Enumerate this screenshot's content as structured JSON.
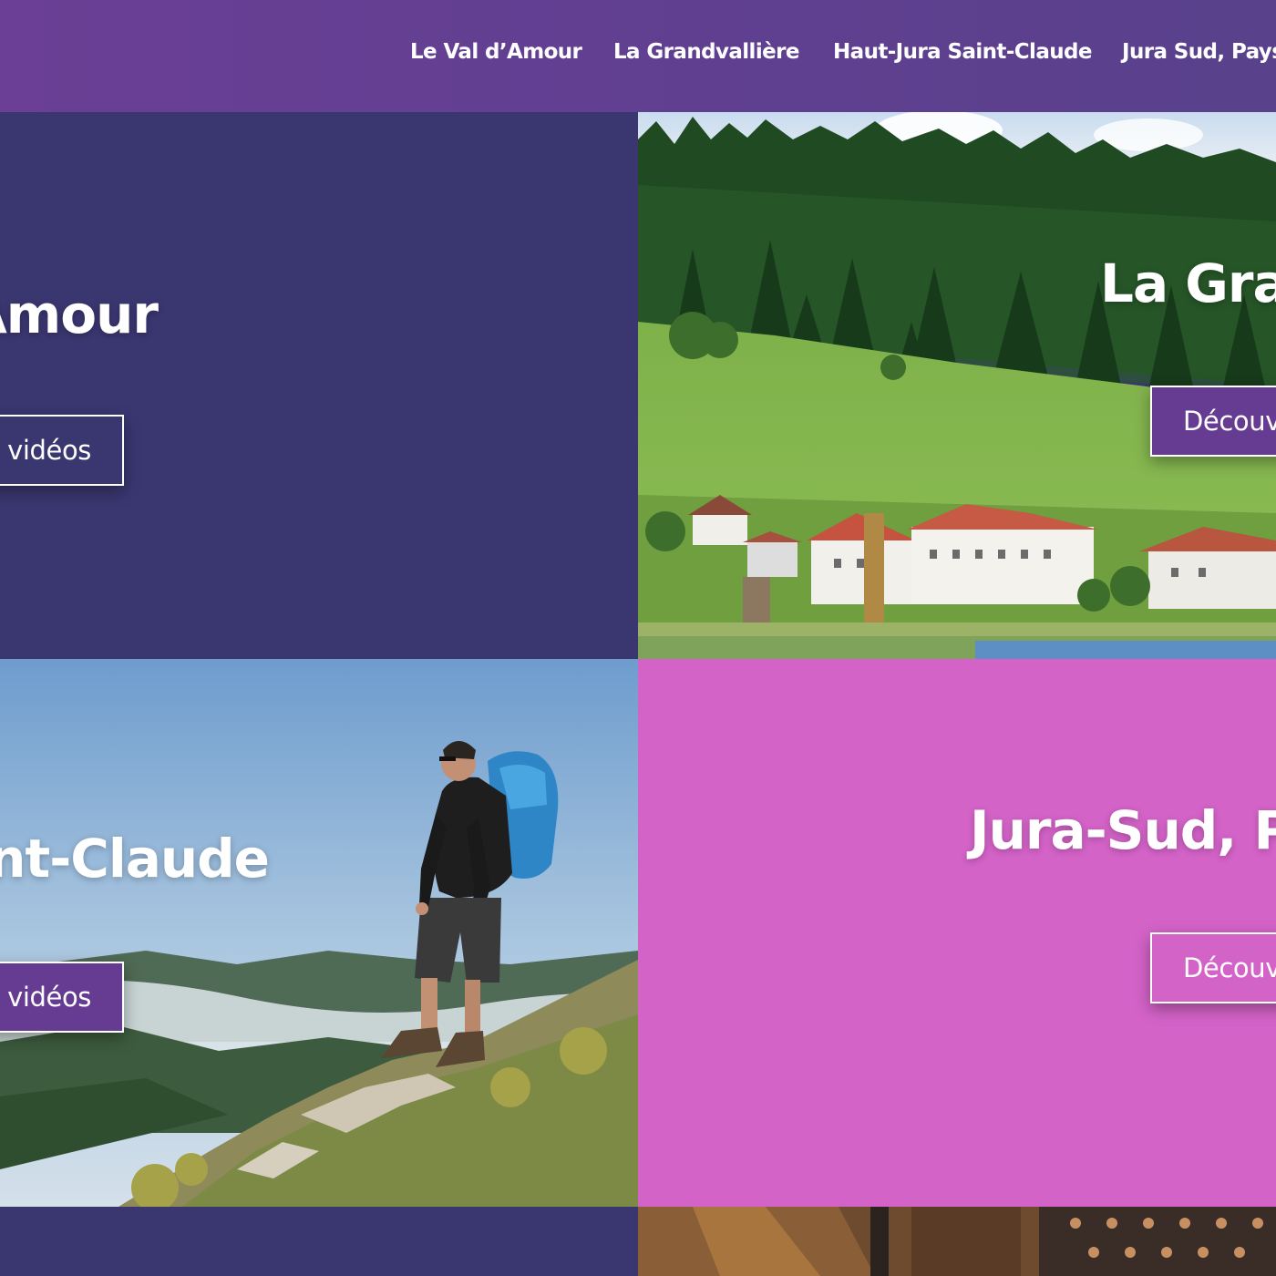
{
  "nav": {
    "items": [
      {
        "label": "Le Val d’Amour"
      },
      {
        "label": "La Grandvallière"
      },
      {
        "label": "Haut-Jura Saint-Claude"
      },
      {
        "label": "Jura Sud, Pays"
      }
    ]
  },
  "tiles": [
    {
      "title": "Amour",
      "button": "vidéos",
      "bg": "#3a3670"
    },
    {
      "title": "La Gra",
      "button": "Découv",
      "image": "lake-village-forest-image"
    },
    {
      "title": "nt-Claude",
      "button": "vidéos",
      "image": "hiker-mountain-image"
    },
    {
      "title": "Jura-Sud, P",
      "button": "Découv",
      "bg": "#d463c8"
    }
  ],
  "colors": {
    "nav_bg": "#6a3f95",
    "dark_tile": "#3a3670",
    "pink_tile": "#d463c8",
    "purple_button": "#663c93"
  }
}
